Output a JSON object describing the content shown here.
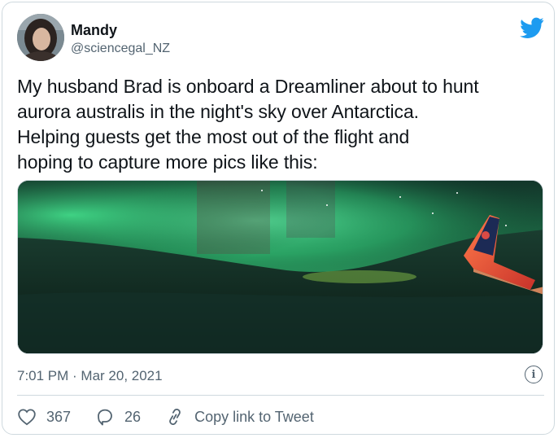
{
  "user": {
    "name": "Mandy",
    "handle": "@sciencegal_NZ"
  },
  "tweet": {
    "lines": [
      "My husband Brad is onboard a Dreamliner about to hunt",
      "aurora australis in the night's sky over Antarctica.",
      "Helping guests get the most out of the flight and",
      "hoping to capture more pics like this:"
    ],
    "media_icon": "aurora-photo",
    "timestamp": "7:01 PM · Mar 20, 2021"
  },
  "actions": {
    "likes": "367",
    "replies": "26",
    "copy_link": "Copy link to Tweet"
  },
  "icons": {
    "brand": "twitter-bird-icon",
    "info": "info-icon",
    "like": "heart-icon",
    "reply": "reply-icon",
    "link": "link-icon"
  },
  "colors": {
    "brand": "#1d9bf0",
    "text": "#0f1419",
    "secondary": "#536471",
    "border": "#cfd9de",
    "aurora": "#3fe38a"
  }
}
